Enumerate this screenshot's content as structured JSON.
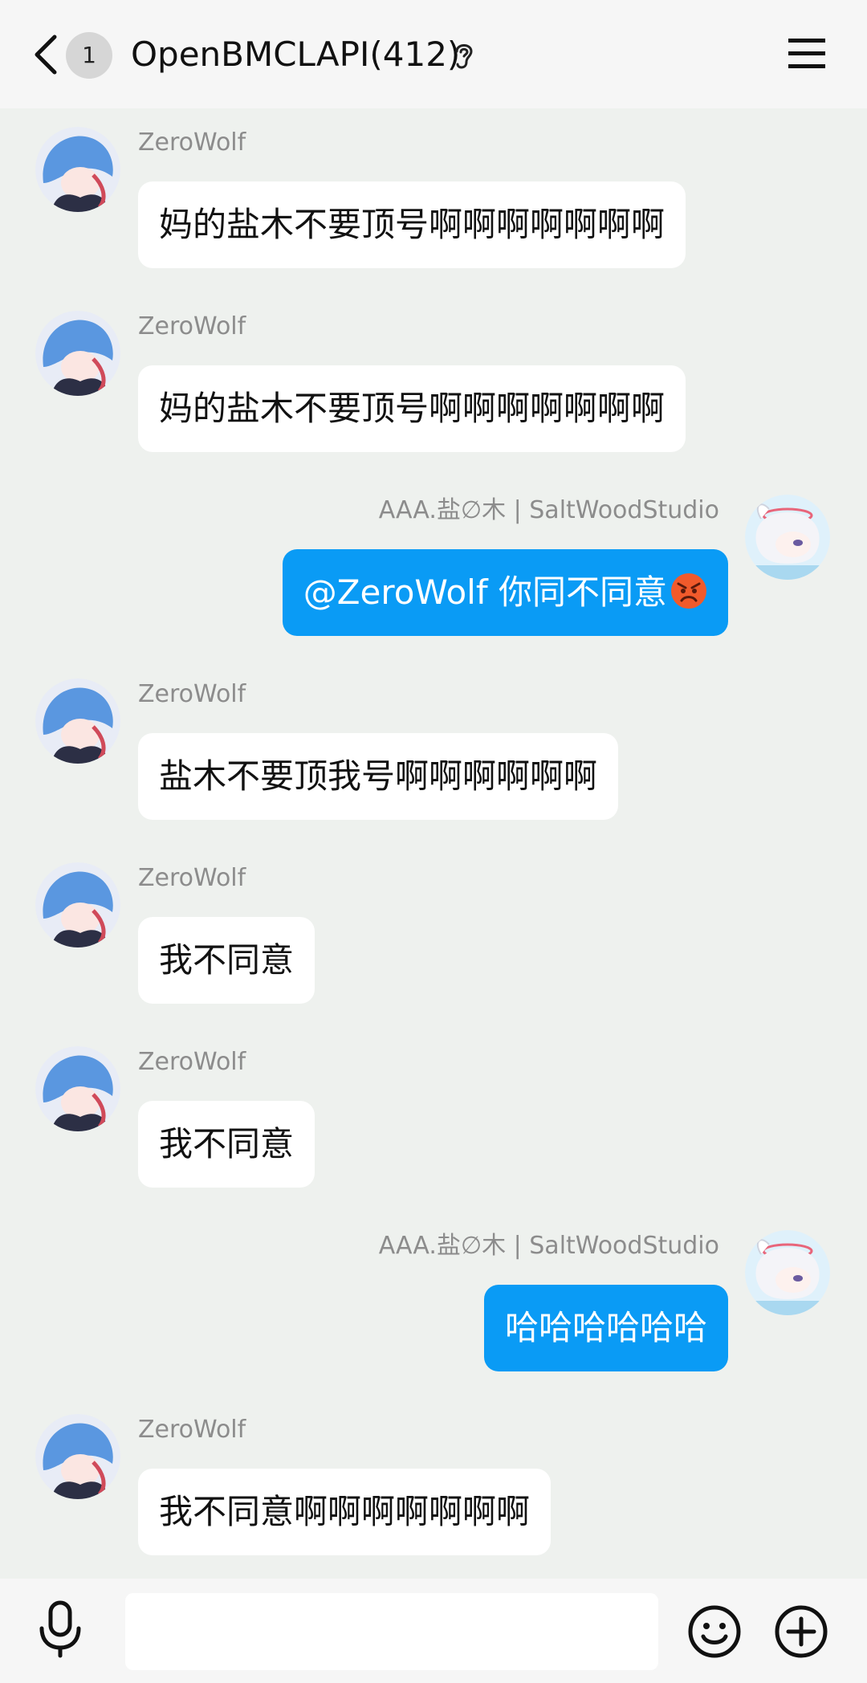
{
  "header": {
    "unread_count": "1",
    "title": "OpenBMCLAPI(412)"
  },
  "messages": [
    {
      "side": "left",
      "sender": "ZeroWolf",
      "text": "妈的盐木不要顶号啊啊啊啊啊啊啊"
    },
    {
      "side": "left",
      "sender": "ZeroWolf",
      "text": "妈的盐木不要顶号啊啊啊啊啊啊啊"
    },
    {
      "side": "right",
      "sender": "AAA.盐∅木 | SaltWoodStudio",
      "text": "@ZeroWolf 你同不同意",
      "emoji": "angry-face"
    },
    {
      "side": "left",
      "sender": "ZeroWolf",
      "text": "盐木不要顶我号啊啊啊啊啊啊"
    },
    {
      "side": "left",
      "sender": "ZeroWolf",
      "text": "我不同意"
    },
    {
      "side": "left",
      "sender": "ZeroWolf",
      "text": "我不同意"
    },
    {
      "side": "right",
      "sender": "AAA.盐∅木 | SaltWoodStudio",
      "text": "哈哈哈哈哈哈"
    },
    {
      "side": "left",
      "sender": "ZeroWolf",
      "text": "我不同意啊啊啊啊啊啊啊"
    }
  ],
  "input": {
    "value": "",
    "placeholder": ""
  },
  "icons": {
    "back": "chevron-left-icon",
    "ear": "ear-icon",
    "menu": "hamburger-menu-icon",
    "mic": "microphone-icon",
    "emoji": "smiley-icon",
    "plus": "plus-circle-icon"
  },
  "colors": {
    "accent_bubble": "#0a9bf5",
    "chat_background": "#eef1ee",
    "header_background": "#f6f6f6",
    "sender_name": "#8c8c8c"
  }
}
